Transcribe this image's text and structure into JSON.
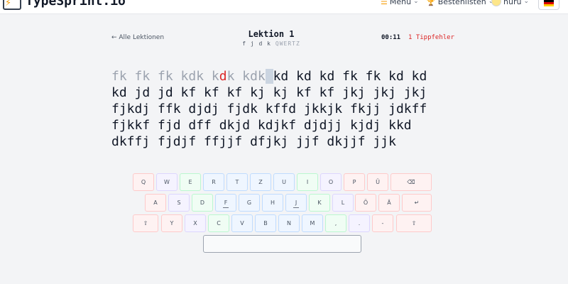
{
  "app": {
    "brand": "TypeSprint.io",
    "nav": {
      "menu_label": "Menü",
      "leaderboard_label": "Bestenlisten",
      "user_label": "nuru",
      "language_flag": [
        "#000000",
        "#dd0000",
        "#ffce00"
      ]
    }
  },
  "lesson": {
    "back_label": "← Alle Lektionen",
    "title": "Lektion 1",
    "keys": "f j d k",
    "layout": "QWERTZ",
    "timer": "00:11",
    "errors": "1 Tippfehler"
  },
  "text": {
    "lines": [
      [
        {
          "t": "fk fk fk kdk k",
          "s": "typed"
        },
        {
          "t": "d",
          "s": "wrong"
        },
        {
          "t": "k kdk",
          "s": "typed"
        },
        {
          "t": " ",
          "s": "cursor"
        },
        {
          "t": "kd kd kd fk fk kd kd",
          "s": "pending"
        }
      ],
      [
        {
          "t": "kd jd jd kf kf kf kj kj kf kf jkj jkj jkj",
          "s": "pending"
        }
      ],
      [
        {
          "t": "fjkdj ffk djdj fjdk kffd jkkjk fkjj jdkff",
          "s": "pending"
        }
      ],
      [
        {
          "t": "fjkkf fjd dff dkjd kdjkf djdjj kjdj kkd",
          "s": "pending"
        }
      ],
      [
        {
          "t": "dkffj fjdjf ffjjf dfjkj jjf dkjjf jjk",
          "s": "pending"
        }
      ]
    ]
  },
  "keyboard": {
    "rows": [
      [
        {
          "label": "Q",
          "color": "red"
        },
        {
          "label": "W",
          "color": "purple"
        },
        {
          "label": "E",
          "color": "green"
        },
        {
          "label": "R",
          "color": "blue"
        },
        {
          "label": "T",
          "color": "blue"
        },
        {
          "label": "Z",
          "color": "blue"
        },
        {
          "label": "U",
          "color": "blue"
        },
        {
          "label": "I",
          "color": "green"
        },
        {
          "label": "O",
          "color": "purple"
        },
        {
          "label": "P",
          "color": "red"
        },
        {
          "label": "Ü",
          "color": "red"
        },
        {
          "label": "⌫",
          "color": "red"
        }
      ],
      [
        {
          "label": "A",
          "color": "red"
        },
        {
          "label": "S",
          "color": "purple"
        },
        {
          "label": "D",
          "color": "green"
        },
        {
          "label": "F",
          "color": "blue",
          "home": true
        },
        {
          "label": "G",
          "color": "blue"
        },
        {
          "label": "H",
          "color": "blue"
        },
        {
          "label": "J",
          "color": "blue",
          "home": true
        },
        {
          "label": "K",
          "color": "green"
        },
        {
          "label": "L",
          "color": "purple"
        },
        {
          "label": "Ö",
          "color": "red"
        },
        {
          "label": "Ä",
          "color": "red"
        },
        {
          "label": "↵",
          "color": "red"
        }
      ],
      [
        {
          "label": "⇧",
          "color": "red"
        },
        {
          "label": "Y",
          "color": "red"
        },
        {
          "label": "X",
          "color": "purple"
        },
        {
          "label": "C",
          "color": "green"
        },
        {
          "label": "V",
          "color": "blue"
        },
        {
          "label": "B",
          "color": "blue"
        },
        {
          "label": "N",
          "color": "blue"
        },
        {
          "label": "M",
          "color": "blue"
        },
        {
          "label": ",",
          "color": "green"
        },
        {
          "label": ".",
          "color": "purple"
        },
        {
          "label": "-",
          "color": "red"
        },
        {
          "label": "⇧",
          "color": "red"
        }
      ]
    ]
  }
}
